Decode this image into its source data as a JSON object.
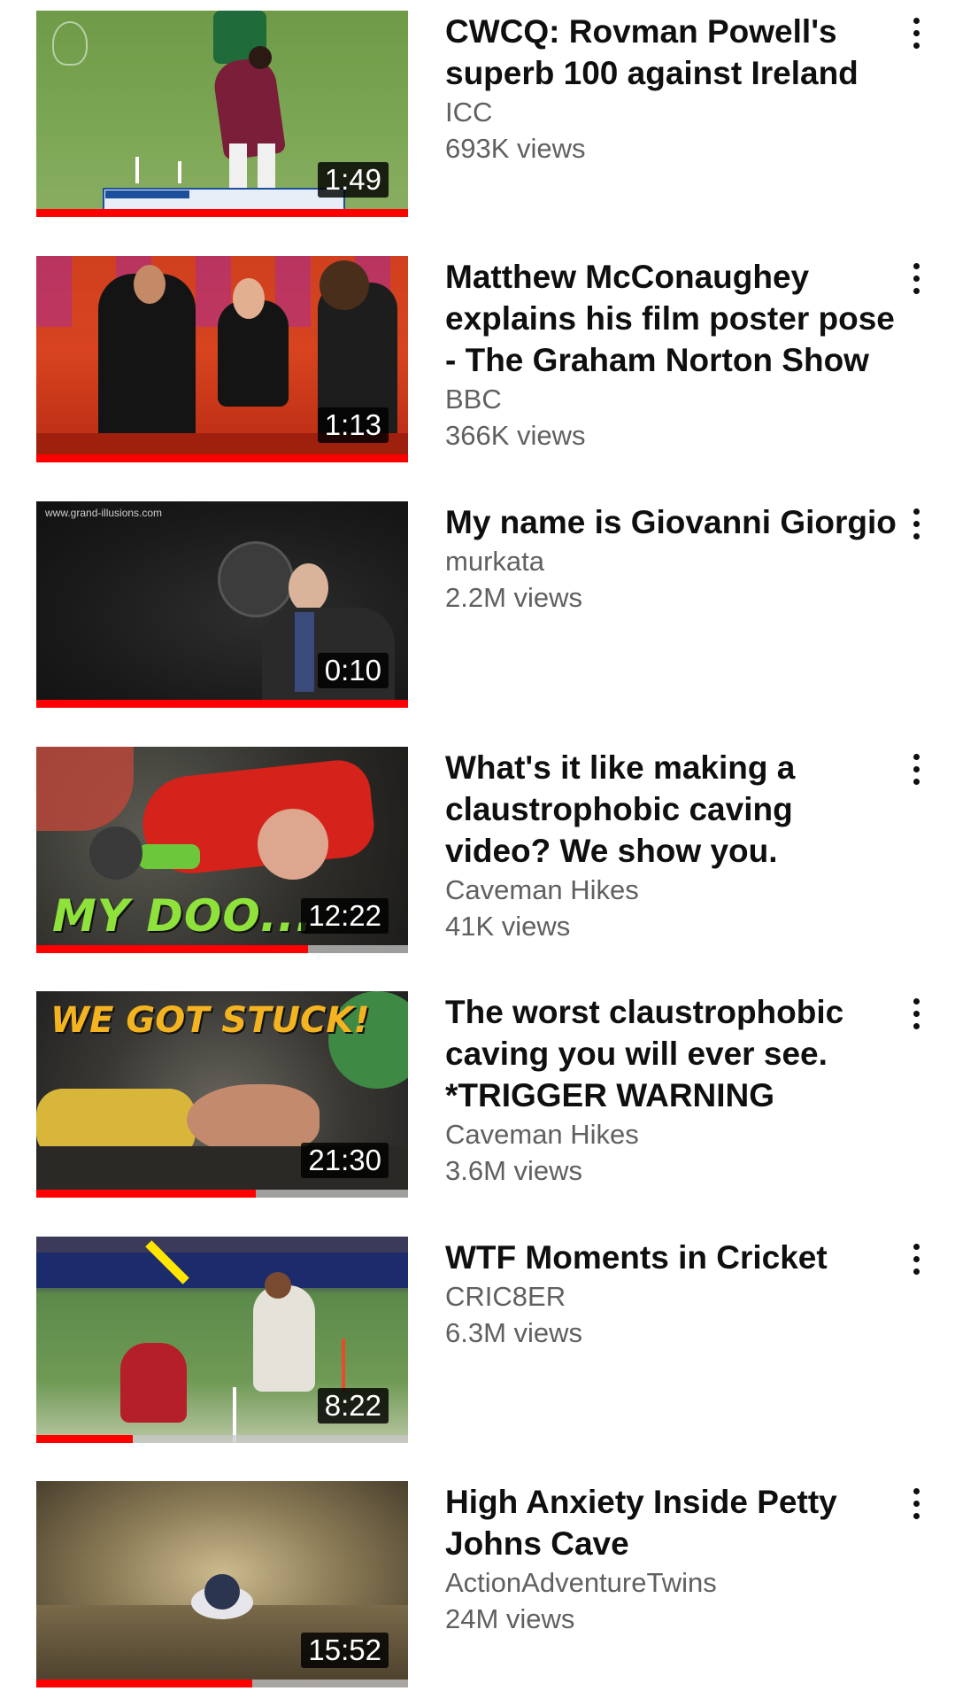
{
  "videos": [
    {
      "title": "CWCQ: Rovman Powell's superb 100 against Ireland",
      "channel": "ICC",
      "views": "693K views",
      "duration": "1:49",
      "progress": 1.0,
      "thumbnail": "cricket-batsman"
    },
    {
      "title": "Matthew McConaughey explains his film poster pose - The Graham Norton Show",
      "channel": "BBC",
      "views": "366K views",
      "duration": "1:13",
      "progress": 1.0,
      "thumbnail": "talk-show-couch"
    },
    {
      "title": "My name is Giovanni Giorgio",
      "channel": "murkata",
      "views": "2.2M views",
      "duration": "0:10",
      "progress": 1.0,
      "thumbnail": "man-with-helmet",
      "watermark": "www.grand-illusions.com"
    },
    {
      "title": "What's it like making a claustrophobic caving video? We show you.",
      "channel": "Caveman Hikes",
      "views": "41K views",
      "duration": "12:22",
      "progress": 0.73,
      "thumbnail": "caver-red-jacket",
      "overlay": "MY DOO..."
    },
    {
      "title": "The worst claustrophobic caving you will ever see. *TRIGGER WARNING",
      "channel": "Caveman Hikes",
      "views": "3.6M views",
      "duration": "21:30",
      "progress": 0.59,
      "thumbnail": "caver-stuck",
      "overlay": "WE GOT STUCK!"
    },
    {
      "title": "WTF Moments in Cricket",
      "channel": "CRIC8ER",
      "views": "6.3M views",
      "duration": "8:22",
      "progress": 0.26,
      "thumbnail": "cricket-runout"
    },
    {
      "title": "High Anxiety Inside Petty Johns Cave",
      "channel": "ActionAdventureTwins",
      "views": "24M views",
      "duration": "15:52",
      "progress": 0.58,
      "thumbnail": "cave-crawl"
    }
  ],
  "colors": {
    "progress": "#ff0000",
    "title": "#0f0f0f",
    "meta": "#606060"
  },
  "icons": {
    "menu": "more-vert-icon"
  }
}
